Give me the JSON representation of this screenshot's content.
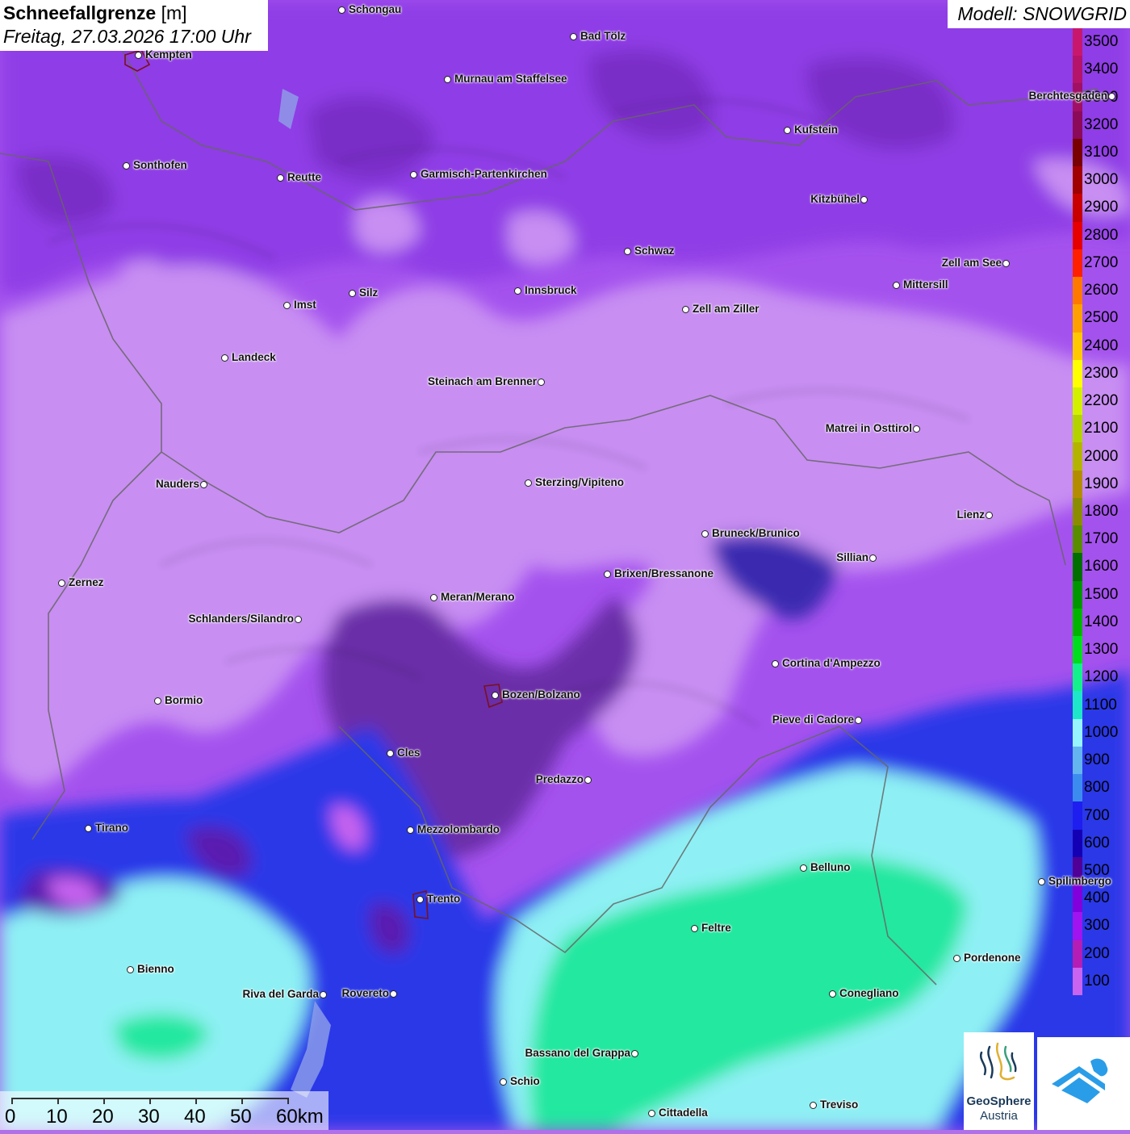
{
  "title": {
    "main": "Schneefallgrenze",
    "unit": "[m]",
    "datetime": "Freitag, 27.03.2026 17:00 Uhr"
  },
  "model": {
    "label": "Modell: SNOWGRID"
  },
  "legend": {
    "items": [
      {
        "label": "3500",
        "color": "#c8186e"
      },
      {
        "label": "3400",
        "color": "#b4146a"
      },
      {
        "label": "3300",
        "color": "#a01064"
      },
      {
        "label": "3200",
        "color": "#8c0a5a"
      },
      {
        "label": "3100",
        "color": "#780000"
      },
      {
        "label": "3000",
        "color": "#a00000"
      },
      {
        "label": "2900",
        "color": "#c80000"
      },
      {
        "label": "2800",
        "color": "#e60000"
      },
      {
        "label": "2700",
        "color": "#ff2000"
      },
      {
        "label": "2600",
        "color": "#ff7800"
      },
      {
        "label": "2500",
        "color": "#ffa000"
      },
      {
        "label": "2400",
        "color": "#ffc800"
      },
      {
        "label": "2300",
        "color": "#ffff00"
      },
      {
        "label": "2200",
        "color": "#d2f000"
      },
      {
        "label": "2100",
        "color": "#b4d200"
      },
      {
        "label": "2000",
        "color": "#b4b400"
      },
      {
        "label": "1900",
        "color": "#b48c00"
      },
      {
        "label": "1800",
        "color": "#8c8c00"
      },
      {
        "label": "1700",
        "color": "#5a8c00"
      },
      {
        "label": "1600",
        "color": "#006e00"
      },
      {
        "label": "1500",
        "color": "#009600"
      },
      {
        "label": "1400",
        "color": "#00b400"
      },
      {
        "label": "1300",
        "color": "#00dc1e"
      },
      {
        "label": "1200",
        "color": "#14f08c"
      },
      {
        "label": "1100",
        "color": "#1ee6c8"
      },
      {
        "label": "1000",
        "color": "#96f5ff"
      },
      {
        "label": "900",
        "color": "#64b4f0"
      },
      {
        "label": "800",
        "color": "#3c8cf0"
      },
      {
        "label": "700",
        "color": "#1e1ef0"
      },
      {
        "label": "600",
        "color": "#1400b4"
      },
      {
        "label": "500",
        "color": "#500096"
      },
      {
        "label": "400",
        "color": "#8200dc"
      },
      {
        "label": "300",
        "color": "#a014f0"
      },
      {
        "label": "200",
        "color": "#b41eb4"
      },
      {
        "label": "100",
        "color": "#c864f0"
      }
    ]
  },
  "cities": [
    {
      "name": "Schongau",
      "label_side": "right"
    },
    {
      "name": "Kempten",
      "label_side": "right"
    },
    {
      "name": "Bad Tölz",
      "label_side": "right"
    },
    {
      "name": "Murnau am Staffelsee",
      "label_side": "right"
    },
    {
      "name": "Berchtesgaden",
      "label_side": "left"
    },
    {
      "name": "Kufstein",
      "label_side": "right"
    },
    {
      "name": "Sonthofen",
      "label_side": "right"
    },
    {
      "name": "Reutte",
      "label_side": "right"
    },
    {
      "name": "Garmisch-Partenkirchen",
      "label_side": "right"
    },
    {
      "name": "Kitzbühel",
      "label_side": "left"
    },
    {
      "name": "Schwaz",
      "label_side": "right"
    },
    {
      "name": "Zell am See",
      "label_side": "left"
    },
    {
      "name": "Innsbruck",
      "label_side": "right"
    },
    {
      "name": "Mittersill",
      "label_side": "right"
    },
    {
      "name": "Imst",
      "label_side": "right"
    },
    {
      "name": "Silz",
      "label_side": "right"
    },
    {
      "name": "Zell am Ziller",
      "label_side": "right"
    },
    {
      "name": "Landeck",
      "label_side": "right"
    },
    {
      "name": "Steinach am Brenner",
      "label_side": "left"
    },
    {
      "name": "Matrei in Osttirol",
      "label_side": "left"
    },
    {
      "name": "Nauders",
      "label_side": "left"
    },
    {
      "name": "Sterzing/Vipiteno",
      "label_side": "right"
    },
    {
      "name": "Lienz",
      "label_side": "left"
    },
    {
      "name": "Bruneck/Brunico",
      "label_side": "right"
    },
    {
      "name": "Sillian",
      "label_side": "left"
    },
    {
      "name": "Zernez",
      "label_side": "right"
    },
    {
      "name": "Brixen/Bressanone",
      "label_side": "right"
    },
    {
      "name": "Meran/Merano",
      "label_side": "right"
    },
    {
      "name": "Schlanders/Silandro",
      "label_side": "left"
    },
    {
      "name": "Cortina d'Ampezzo",
      "label_side": "right"
    },
    {
      "name": "Bozen/Bolzano",
      "label_side": "right"
    },
    {
      "name": "Bormio",
      "label_side": "right"
    },
    {
      "name": "Pieve di Cadore",
      "label_side": "left"
    },
    {
      "name": "Cles",
      "label_side": "right"
    },
    {
      "name": "Predazzo",
      "label_side": "left"
    },
    {
      "name": "Tirano",
      "label_side": "right"
    },
    {
      "name": "Mezzolombardo",
      "label_side": "right"
    },
    {
      "name": "Belluno",
      "label_side": "right"
    },
    {
      "name": "Spilimbergo",
      "label_side": "right"
    },
    {
      "name": "Trento",
      "label_side": "right"
    },
    {
      "name": "Feltre",
      "label_side": "right"
    },
    {
      "name": "Pordenone",
      "label_side": "right"
    },
    {
      "name": "Bienno",
      "label_side": "right"
    },
    {
      "name": "Riva del Garda",
      "label_side": "left"
    },
    {
      "name": "Rovereto",
      "label_side": "left"
    },
    {
      "name": "Conegliano",
      "label_side": "right"
    },
    {
      "name": "Bassano del Grappa",
      "label_side": "left"
    },
    {
      "name": "Schio",
      "label_side": "right"
    },
    {
      "name": "Treviso",
      "label_side": "right"
    },
    {
      "name": "Cittadella",
      "label_side": "right"
    }
  ],
  "scale_bar": {
    "labels": [
      "0",
      "10",
      "20",
      "30",
      "40",
      "50",
      "60km"
    ]
  },
  "logos": {
    "geosphere_line1": "GeoSphere",
    "geosphere_line2": "Austria"
  }
}
